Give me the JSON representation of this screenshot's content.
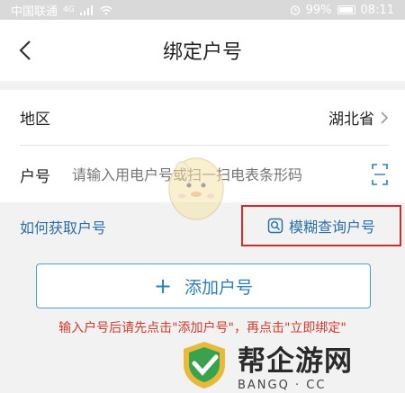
{
  "status_bar": {
    "carrier": "中国联通",
    "network": "4G",
    "battery": "99%",
    "time": "08:11"
  },
  "nav": {
    "title": "绑定户号",
    "back_icon": "chevron-left-icon"
  },
  "form": {
    "region_label": "地区",
    "region_value": "湖北省",
    "account_label": "户号",
    "account_placeholder": "请输入用电户号或扫一扫电表条形码",
    "scan_icon": "scan-icon"
  },
  "links": {
    "how_to_get": "如何获取户号",
    "fuzzy_search": "模糊查询户号"
  },
  "add_button": {
    "icon": "+",
    "label": "添加户号"
  },
  "hint": "输入户号后请先点击\"添加户号\"，再点击\"立即绑定\"",
  "watermark": {
    "title": "帮企游网",
    "subtitle": "BANGQ · CC"
  },
  "colors": {
    "link": "#2a6fa8",
    "highlight": "#d22b2b",
    "hint": "#d03a2a"
  }
}
